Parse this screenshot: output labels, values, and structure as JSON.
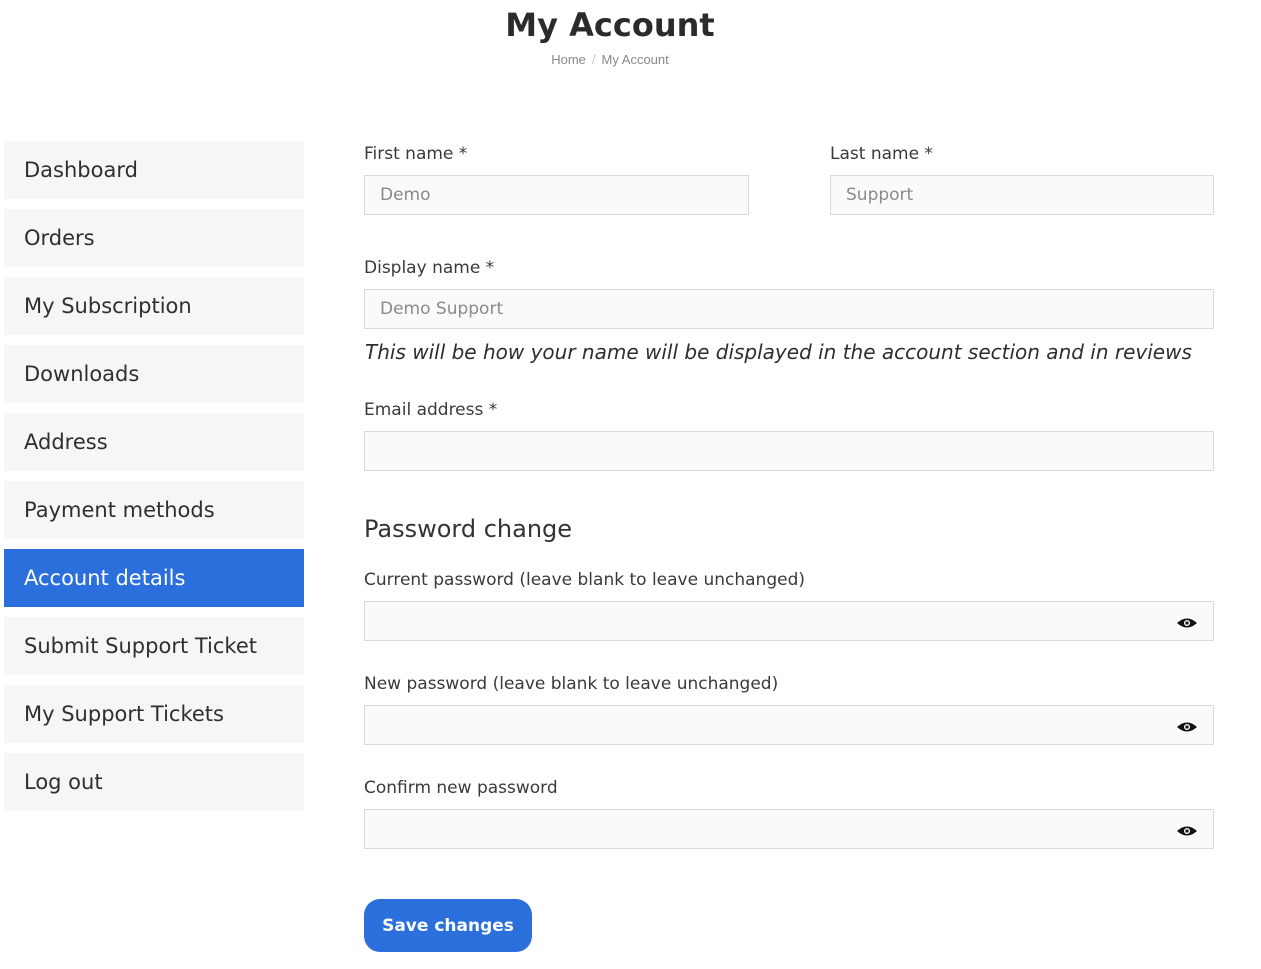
{
  "header": {
    "title": "My Account",
    "breadcrumb": {
      "home": "Home",
      "separator": "/",
      "current": "My Account"
    }
  },
  "sidebar": {
    "items": [
      {
        "label": "Dashboard"
      },
      {
        "label": "Orders"
      },
      {
        "label": "My Subscription"
      },
      {
        "label": "Downloads"
      },
      {
        "label": "Address"
      },
      {
        "label": "Payment methods"
      },
      {
        "label": "Account details",
        "active": true
      },
      {
        "label": "Submit Support Ticket"
      },
      {
        "label": "My Support Tickets"
      },
      {
        "label": "Log out"
      }
    ]
  },
  "form": {
    "first_name": {
      "label": "First name *",
      "value": "Demo"
    },
    "last_name": {
      "label": "Last name *",
      "value": "Support"
    },
    "display_name": {
      "label": "Display name *",
      "value": "Demo Support",
      "hint": "This will be how your name will be displayed in the account section and in reviews"
    },
    "email": {
      "label": "Email address *",
      "value": ""
    },
    "password_section_title": "Password change",
    "current_password": {
      "label": "Current password (leave blank to leave unchanged)",
      "value": ""
    },
    "new_password": {
      "label": "New password (leave blank to leave unchanged)",
      "value": ""
    },
    "confirm_password": {
      "label": "Confirm new password",
      "value": ""
    },
    "save_label": "Save changes"
  },
  "colors": {
    "accent": "#2a6fdb",
    "nav_bg": "#f6f6f6",
    "input_bg": "#fafafa"
  },
  "icons": {
    "password_toggle": "eye-icon"
  }
}
